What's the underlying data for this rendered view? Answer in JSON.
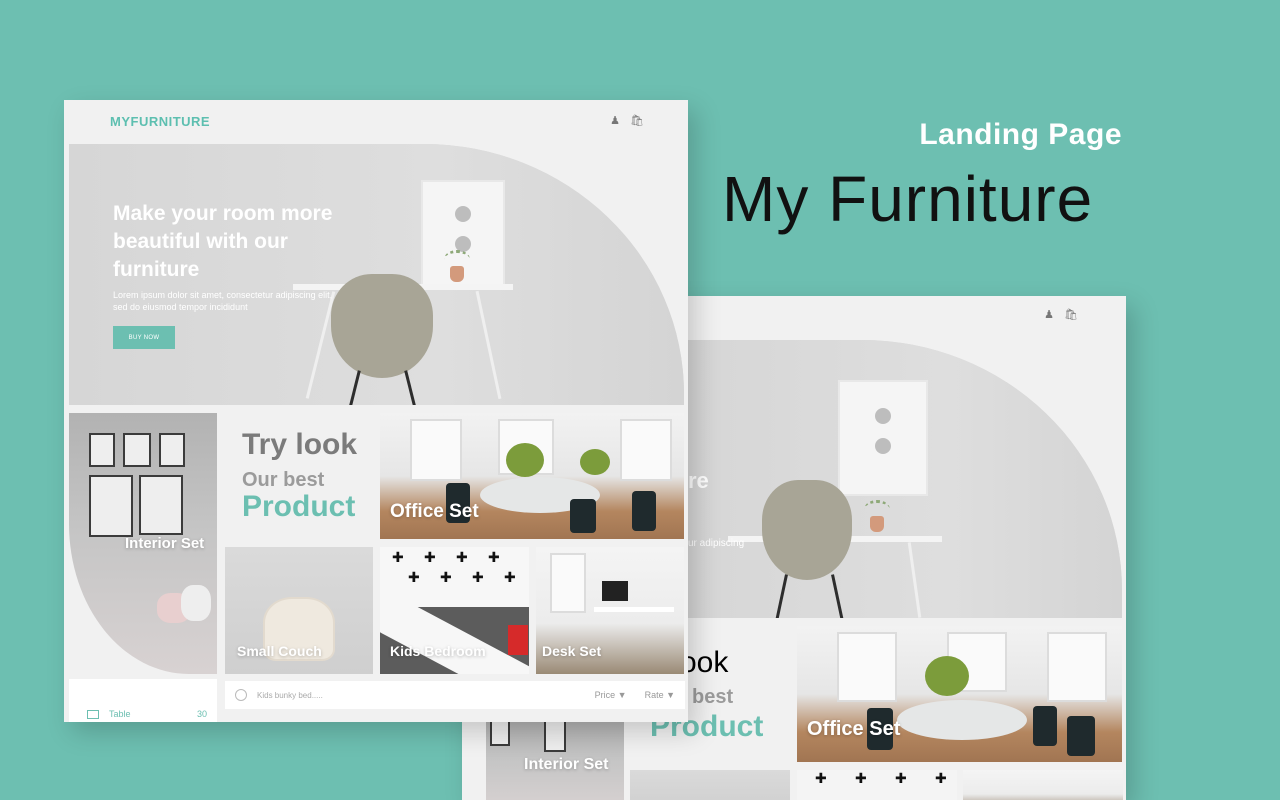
{
  "header": {
    "subtitle": "Landing Page",
    "title": "My Furniture"
  },
  "site": {
    "logo": "MYFURNITURE",
    "icons": [
      "user-icon",
      "cart-icon"
    ]
  },
  "hero": {
    "title": "Make your room more beautiful with our furniture",
    "description": "Lorem ipsum dolor sit amet, consectetur adipiscing elit, sed do eiusmod tempor incididunt",
    "button": "BUY NOW",
    "partial_title": "re",
    "partial_desc": "ur adipiscing"
  },
  "promo": {
    "line1": "Try look",
    "line2": "Our best",
    "line3": "Product"
  },
  "back_promo": {
    "line1": "y look",
    "line2": "best",
    "line3": "Product"
  },
  "tiles": {
    "interior": "Interior Set",
    "office": "Office Set",
    "couch": "Small Couch",
    "kids": "Kids Bedroom",
    "desk": "Desk Set"
  },
  "search": {
    "placeholder": "Kids bunky bed.....",
    "filters": [
      "Price ▼",
      "Rate ▼"
    ]
  },
  "sidebar": {
    "item": "Table",
    "count": "30"
  },
  "colors": {
    "background": "#6dbfb1",
    "accent": "#6cbfb1"
  }
}
